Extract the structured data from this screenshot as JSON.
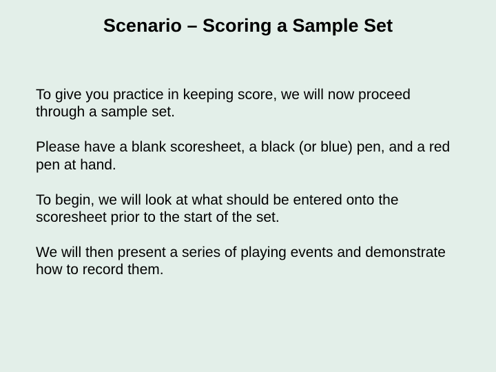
{
  "slide": {
    "title": "Scenario – Scoring a Sample Set",
    "paragraphs": [
      "To give you practice in keeping score, we will now proceed through a sample set.",
      "Please have a blank scoresheet, a black (or blue) pen, and a red pen at hand.",
      "To begin, we will look at what should be entered onto the scoresheet prior to the start of the set.",
      "We will then present a series of playing events and demonstrate how to record them."
    ]
  }
}
